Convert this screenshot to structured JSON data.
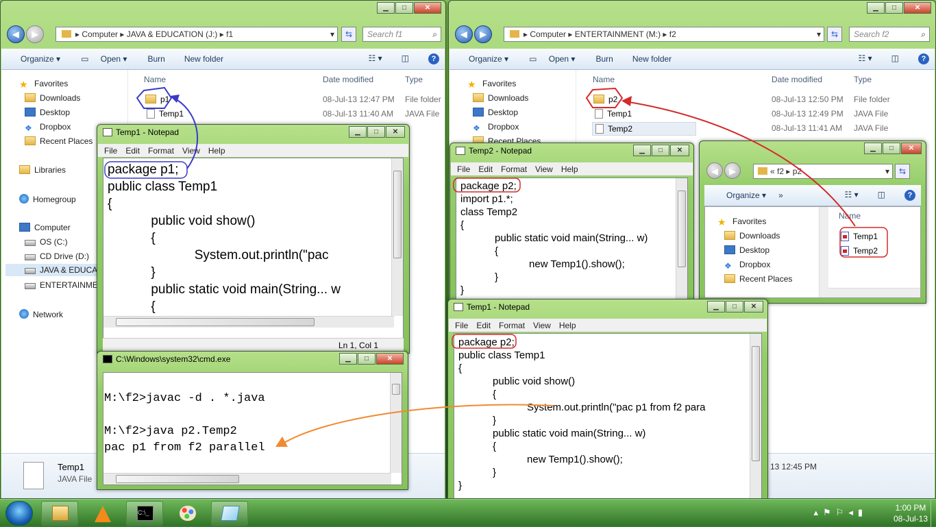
{
  "left_explorer": {
    "breadcrumb": [
      "Computer",
      "JAVA & EDUCATION (J:)",
      "f1"
    ],
    "search_placeholder": "Search f1",
    "toolbar": {
      "organize": "Organize",
      "open": "Open",
      "burn": "Burn",
      "new_folder": "New folder"
    },
    "nav": [
      "Favorites",
      "Downloads",
      "Desktop",
      "Dropbox",
      "Recent Places",
      "Libraries",
      "Homegroup",
      "Computer",
      "OS (C:)",
      "CD Drive (D:)",
      "JAVA & EDUCAT",
      "ENTERTAINMEN",
      "Network"
    ],
    "columns": {
      "name": "Name",
      "date": "Date modified",
      "type": "Type"
    },
    "rows": [
      {
        "name": "p1",
        "date": "08-Jul-13 12:47 PM",
        "type": "File folder"
      },
      {
        "name": "Temp1",
        "date": "08-Jul-13 11:40 AM",
        "type": "JAVA File"
      }
    ],
    "details": {
      "name": "Temp1",
      "type": "JAVA File"
    }
  },
  "right_explorer": {
    "breadcrumb": [
      "Computer",
      "ENTERTAINMENT (M:)",
      "f2"
    ],
    "search_placeholder": "Search f2",
    "toolbar": {
      "organize": "Organize",
      "open": "Open",
      "burn": "Burn",
      "new_folder": "New folder"
    },
    "nav": [
      "Favorites",
      "Downloads",
      "Desktop",
      "Dropbox",
      "Recent Places"
    ],
    "columns": {
      "name": "Name",
      "date": "Date modified",
      "type": "Type"
    },
    "rows": [
      {
        "name": "p2",
        "date": "08-Jul-13 12:50 PM",
        "type": "File folder"
      },
      {
        "name": "Temp1",
        "date": "08-Jul-13 12:49 PM",
        "type": "JAVA File"
      },
      {
        "name": "Temp2",
        "date": "08-Jul-13 11:41 AM",
        "type": "JAVA File"
      }
    ],
    "details_date": "13 12:45 PM"
  },
  "small_explorer": {
    "breadcrumb": [
      "«",
      "f2",
      "p2"
    ],
    "toolbar": {
      "organize": "Organize",
      "more": "»"
    },
    "nav": [
      "Favorites",
      "Downloads",
      "Desktop",
      "Dropbox",
      "Recent Places"
    ],
    "column": "Name",
    "files": [
      "Temp1",
      "Temp2"
    ]
  },
  "notepad_left": {
    "title": "Temp1 - Notepad",
    "menu": [
      "File",
      "Edit",
      "Format",
      "View",
      "Help"
    ],
    "lines": [
      "package p1;",
      "public class Temp1",
      "{",
      "            public void show()",
      "            {",
      "                        System.out.println(\"pac",
      "            }",
      "            public static void main(String... w",
      "            {"
    ],
    "status": "Ln 1, Col 1"
  },
  "notepad_temp2": {
    "title": "Temp2 - Notepad",
    "menu": [
      "File",
      "Edit",
      "Format",
      "View",
      "Help"
    ],
    "lines": [
      "package p2;",
      "import p1.*;",
      "class Temp2",
      "{",
      "            public static void main(String... w)",
      "            {",
      "                        new Temp1().show();",
      "            }",
      "}"
    ]
  },
  "notepad_temp1_p2": {
    "title": "Temp1 - Notepad",
    "menu": [
      "File",
      "Edit",
      "Format",
      "View",
      "Help"
    ],
    "lines": [
      "package p2;",
      "public class Temp1",
      "{",
      "            public void show()",
      "            {",
      "                        System.out.println(\"pac p1 from f2 para",
      "            }",
      "            public static void main(String... w)",
      "            {",
      "                        new Temp1().show();",
      "            }",
      "}"
    ]
  },
  "cmd": {
    "title": "C:\\Windows\\system32\\cmd.exe",
    "lines": [
      "",
      "M:\\f2>javac -d . *.java",
      "",
      "M:\\f2>java p2.Temp2",
      "pac p1 from f2 parallel"
    ]
  },
  "taskbar": {
    "time": "1:00 PM",
    "date": "08-Jul-13"
  },
  "colors": {
    "annot_blue": "#3a3ac8",
    "annot_red": "#d42a2a",
    "annot_orange": "#f08a30"
  }
}
